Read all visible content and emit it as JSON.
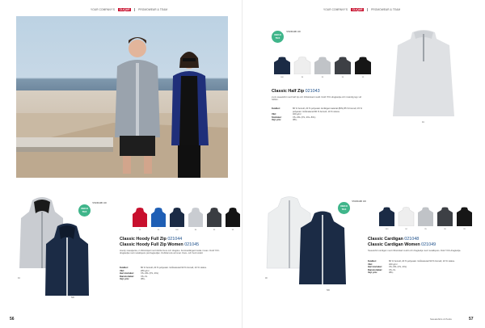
{
  "header": {
    "left": {
      "text1": "YOUR COMPANY'S",
      "brand": "CLIQUE",
      "text2": "PROMOWEAR & TEAM"
    },
    "right": {
      "text1": "YOUR COMPANY'S",
      "brand": "CLIQUE",
      "text2": "PROMOWEAR & TEAM"
    }
  },
  "badges": {
    "main": {
      "text": "OEKO TEX",
      "cert": "STANDARD 100"
    },
    "left": {
      "text": "OEKO TEX",
      "cert": "STANDARD 100"
    },
    "right": {
      "text": "OEKO TEX",
      "cert": "STANDARD 100"
    }
  },
  "half_zip": {
    "name": "Classic Half Zip",
    "code": "021043",
    "description": "2-ply sweatshirt med half zip och ribbstickad mudd. Dold YKK-dragkedja och invändig tejp vid halsen.",
    "specs": [
      {
        "key": "Kvalitet:",
        "value": "80 % bomull, 20 % polyester. Enfärgat material (B/N) 85 % bomull, 15 % polyester. Gråmelerad 90 % bomull, 10 % viskos."
      },
      {
        "key": "Vikt:",
        "value": "320 g/m²"
      },
      {
        "key": "Storlekar:",
        "value": "XS–3XL (XS, 4XL–5XL)"
      },
      {
        "key": "Vejl. pris:",
        "value": "384,-"
      }
    ],
    "swatch_codes": [
      "580",
      "94",
      "95",
      "96",
      "99"
    ],
    "hero_code": "94"
  },
  "hoody": {
    "name1": "Classic Hoody Full Zip",
    "code1": "021044",
    "name2": "Classic Hoody Full Zip Women",
    "code2": "021045",
    "description": "Hoody sweatjacka, 2-ribbstickad med dubbel luva och dragsko. Kontrastfärgad insida i luvan. Dold YKK-dragkedja med metallspets på dragkedjan. Dubbla lock-sömmar. Dam- och herrmodell.",
    "specs": [
      {
        "key": "Kvalitet:",
        "value": "80 % bomull, 20 % polyester. Gråmelerad 90 % bomull, 10 % viskos."
      },
      {
        "key": "Vikt:",
        "value": "280 g/m²"
      },
      {
        "key": "Herrstorlekar:",
        "value": "XS–4XL (XS, 4XL)"
      },
      {
        "key": "Damstorlekar:",
        "value": "XS–XL"
      },
      {
        "key": "Vejl. pris:",
        "value": "384,-"
      }
    ],
    "swatch_codes": [
      "35",
      "55",
      "580",
      "94",
      "95",
      "99"
    ],
    "item_codes": [
      "94",
      "580"
    ]
  },
  "cardigan": {
    "name1": "Classic Cardigan",
    "code1": "021048",
    "name2": "Classic Cardigan Women",
    "code2": "021049",
    "description": "Sweatshirt cardigan med ribbstickad mudd och dragkedja med metallspets. Dold YKK-dragkedja.",
    "specs": [
      {
        "key": "Kvalitet:",
        "value": "80 % bomull, 20 % polyester. Gråmelerad 90 % bomull, 10 % viskos."
      },
      {
        "key": "Vikt:",
        "value": "320 g/m²"
      },
      {
        "key": "Herrstorlekar:",
        "value": "XS–3XL (XS, 4XL)"
      },
      {
        "key": "Damstorlekar:",
        "value": "XS–XL"
      },
      {
        "key": "Vejl. pris:",
        "value": "384,-"
      }
    ],
    "swatch_codes": [
      "580",
      "94",
      "95",
      "96",
      "99"
    ],
    "item_codes": [
      "00",
      "580"
    ]
  },
  "footer": {
    "left_folio": "56",
    "right_folio": "57",
    "right_text": "Sweatshirts & Parks"
  },
  "colors": {
    "navy": "#1b2b45",
    "red": "#c8102e",
    "green": "#3fb58a",
    "grey": "#c9ccd1"
  }
}
